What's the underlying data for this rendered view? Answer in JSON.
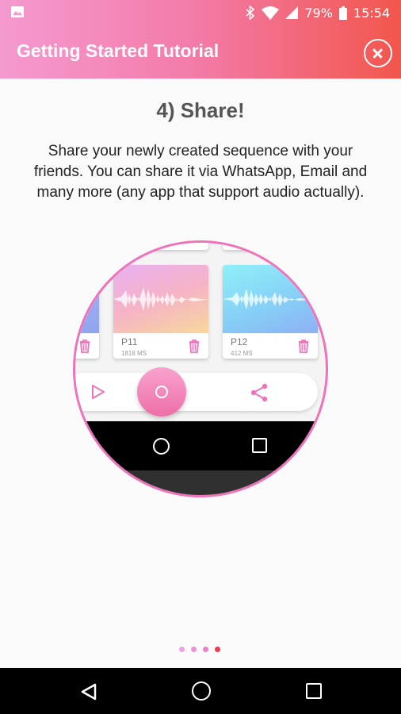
{
  "status_bar": {
    "battery": "79%",
    "time": "15:54",
    "icons": [
      "image-icon",
      "bluetooth-icon",
      "wifi-icon",
      "signal-icon",
      "battery-icon"
    ]
  },
  "app_bar": {
    "title": "Getting Started Tutorial",
    "close_icon": "close-circle-icon"
  },
  "tutorial": {
    "step_title": "4) Share!",
    "description": "Share your newly created sequence with your friends. You can share it via WhatsApp, Email and many more (any app that support audio actually)."
  },
  "illustration": {
    "cards": [
      {
        "name": "P11",
        "duration": "1818 MS"
      },
      {
        "name": "P12",
        "duration": "412 MS"
      }
    ],
    "controls": [
      "play-icon",
      "record-icon",
      "share-icon"
    ]
  },
  "pager": {
    "count": 4,
    "active_index": 3,
    "colors": [
      "#f2a0e6",
      "#f08fd8",
      "#ee7fc8",
      "#f03a4c"
    ]
  },
  "colors": {
    "accent_pink": "#ee73bb",
    "header_start": "#f49ad0",
    "header_end": "#f2564c"
  }
}
